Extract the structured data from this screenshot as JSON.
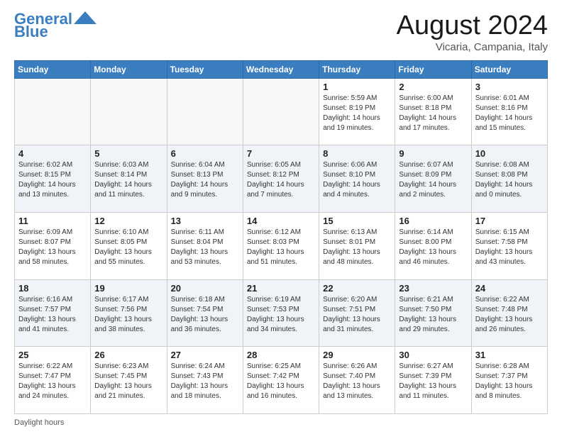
{
  "header": {
    "logo_line1": "General",
    "logo_line2": "Blue",
    "month_title": "August 2024",
    "location": "Vicaria, Campania, Italy"
  },
  "footer": {
    "daylight_label": "Daylight hours"
  },
  "days_of_week": [
    "Sunday",
    "Monday",
    "Tuesday",
    "Wednesday",
    "Thursday",
    "Friday",
    "Saturday"
  ],
  "weeks": [
    [
      {
        "day": "",
        "empty": true
      },
      {
        "day": "",
        "empty": true
      },
      {
        "day": "",
        "empty": true
      },
      {
        "day": "",
        "empty": true
      },
      {
        "day": "1",
        "sunrise": "Sunrise: 5:59 AM",
        "sunset": "Sunset: 8:19 PM",
        "daylight": "Daylight: 14 hours and 19 minutes."
      },
      {
        "day": "2",
        "sunrise": "Sunrise: 6:00 AM",
        "sunset": "Sunset: 8:18 PM",
        "daylight": "Daylight: 14 hours and 17 minutes."
      },
      {
        "day": "3",
        "sunrise": "Sunrise: 6:01 AM",
        "sunset": "Sunset: 8:16 PM",
        "daylight": "Daylight: 14 hours and 15 minutes."
      }
    ],
    [
      {
        "day": "4",
        "sunrise": "Sunrise: 6:02 AM",
        "sunset": "Sunset: 8:15 PM",
        "daylight": "Daylight: 14 hours and 13 minutes."
      },
      {
        "day": "5",
        "sunrise": "Sunrise: 6:03 AM",
        "sunset": "Sunset: 8:14 PM",
        "daylight": "Daylight: 14 hours and 11 minutes."
      },
      {
        "day": "6",
        "sunrise": "Sunrise: 6:04 AM",
        "sunset": "Sunset: 8:13 PM",
        "daylight": "Daylight: 14 hours and 9 minutes."
      },
      {
        "day": "7",
        "sunrise": "Sunrise: 6:05 AM",
        "sunset": "Sunset: 8:12 PM",
        "daylight": "Daylight: 14 hours and 7 minutes."
      },
      {
        "day": "8",
        "sunrise": "Sunrise: 6:06 AM",
        "sunset": "Sunset: 8:10 PM",
        "daylight": "Daylight: 14 hours and 4 minutes."
      },
      {
        "day": "9",
        "sunrise": "Sunrise: 6:07 AM",
        "sunset": "Sunset: 8:09 PM",
        "daylight": "Daylight: 14 hours and 2 minutes."
      },
      {
        "day": "10",
        "sunrise": "Sunrise: 6:08 AM",
        "sunset": "Sunset: 8:08 PM",
        "daylight": "Daylight: 14 hours and 0 minutes."
      }
    ],
    [
      {
        "day": "11",
        "sunrise": "Sunrise: 6:09 AM",
        "sunset": "Sunset: 8:07 PM",
        "daylight": "Daylight: 13 hours and 58 minutes."
      },
      {
        "day": "12",
        "sunrise": "Sunrise: 6:10 AM",
        "sunset": "Sunset: 8:05 PM",
        "daylight": "Daylight: 13 hours and 55 minutes."
      },
      {
        "day": "13",
        "sunrise": "Sunrise: 6:11 AM",
        "sunset": "Sunset: 8:04 PM",
        "daylight": "Daylight: 13 hours and 53 minutes."
      },
      {
        "day": "14",
        "sunrise": "Sunrise: 6:12 AM",
        "sunset": "Sunset: 8:03 PM",
        "daylight": "Daylight: 13 hours and 51 minutes."
      },
      {
        "day": "15",
        "sunrise": "Sunrise: 6:13 AM",
        "sunset": "Sunset: 8:01 PM",
        "daylight": "Daylight: 13 hours and 48 minutes."
      },
      {
        "day": "16",
        "sunrise": "Sunrise: 6:14 AM",
        "sunset": "Sunset: 8:00 PM",
        "daylight": "Daylight: 13 hours and 46 minutes."
      },
      {
        "day": "17",
        "sunrise": "Sunrise: 6:15 AM",
        "sunset": "Sunset: 7:58 PM",
        "daylight": "Daylight: 13 hours and 43 minutes."
      }
    ],
    [
      {
        "day": "18",
        "sunrise": "Sunrise: 6:16 AM",
        "sunset": "Sunset: 7:57 PM",
        "daylight": "Daylight: 13 hours and 41 minutes."
      },
      {
        "day": "19",
        "sunrise": "Sunrise: 6:17 AM",
        "sunset": "Sunset: 7:56 PM",
        "daylight": "Daylight: 13 hours and 38 minutes."
      },
      {
        "day": "20",
        "sunrise": "Sunrise: 6:18 AM",
        "sunset": "Sunset: 7:54 PM",
        "daylight": "Daylight: 13 hours and 36 minutes."
      },
      {
        "day": "21",
        "sunrise": "Sunrise: 6:19 AM",
        "sunset": "Sunset: 7:53 PM",
        "daylight": "Daylight: 13 hours and 34 minutes."
      },
      {
        "day": "22",
        "sunrise": "Sunrise: 6:20 AM",
        "sunset": "Sunset: 7:51 PM",
        "daylight": "Daylight: 13 hours and 31 minutes."
      },
      {
        "day": "23",
        "sunrise": "Sunrise: 6:21 AM",
        "sunset": "Sunset: 7:50 PM",
        "daylight": "Daylight: 13 hours and 29 minutes."
      },
      {
        "day": "24",
        "sunrise": "Sunrise: 6:22 AM",
        "sunset": "Sunset: 7:48 PM",
        "daylight": "Daylight: 13 hours and 26 minutes."
      }
    ],
    [
      {
        "day": "25",
        "sunrise": "Sunrise: 6:22 AM",
        "sunset": "Sunset: 7:47 PM",
        "daylight": "Daylight: 13 hours and 24 minutes."
      },
      {
        "day": "26",
        "sunrise": "Sunrise: 6:23 AM",
        "sunset": "Sunset: 7:45 PM",
        "daylight": "Daylight: 13 hours and 21 minutes."
      },
      {
        "day": "27",
        "sunrise": "Sunrise: 6:24 AM",
        "sunset": "Sunset: 7:43 PM",
        "daylight": "Daylight: 13 hours and 18 minutes."
      },
      {
        "day": "28",
        "sunrise": "Sunrise: 6:25 AM",
        "sunset": "Sunset: 7:42 PM",
        "daylight": "Daylight: 13 hours and 16 minutes."
      },
      {
        "day": "29",
        "sunrise": "Sunrise: 6:26 AM",
        "sunset": "Sunset: 7:40 PM",
        "daylight": "Daylight: 13 hours and 13 minutes."
      },
      {
        "day": "30",
        "sunrise": "Sunrise: 6:27 AM",
        "sunset": "Sunset: 7:39 PM",
        "daylight": "Daylight: 13 hours and 11 minutes."
      },
      {
        "day": "31",
        "sunrise": "Sunrise: 6:28 AM",
        "sunset": "Sunset: 7:37 PM",
        "daylight": "Daylight: 13 hours and 8 minutes."
      }
    ]
  ]
}
